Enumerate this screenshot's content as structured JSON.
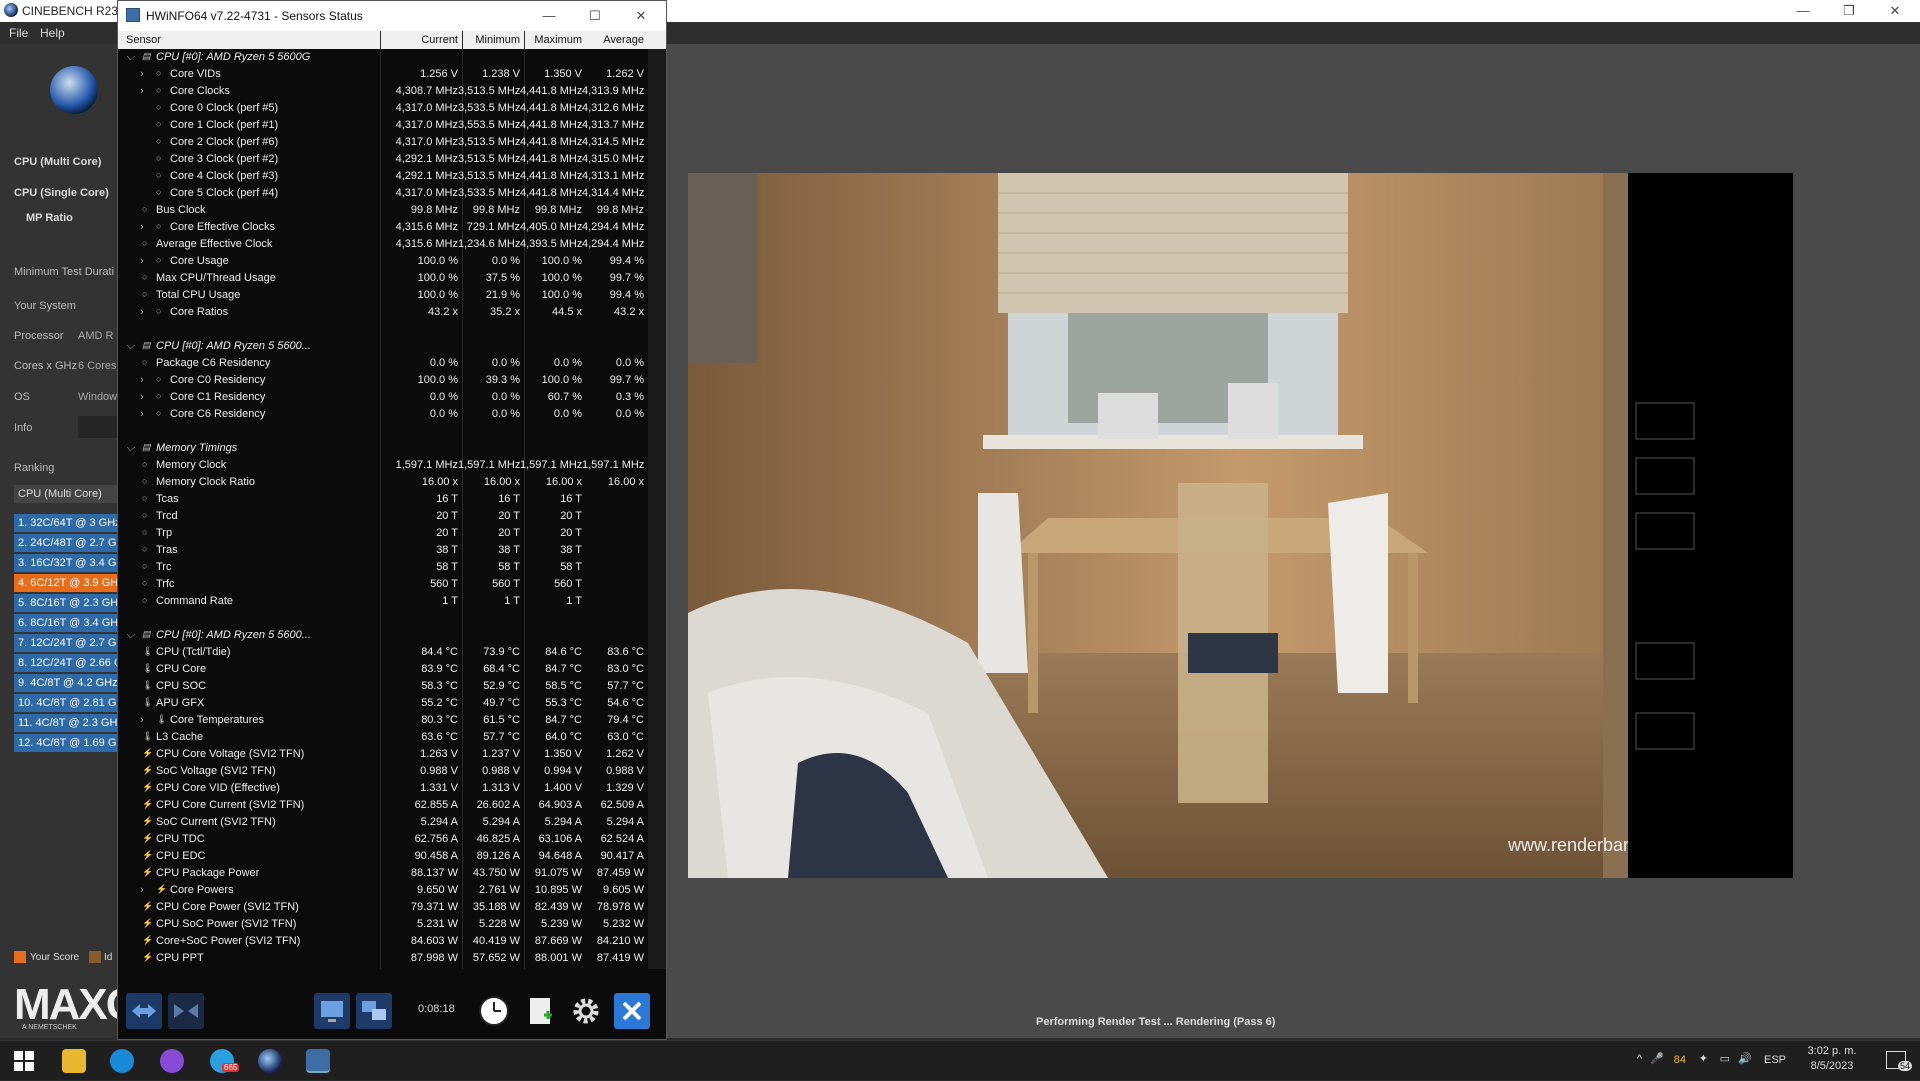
{
  "cinebench": {
    "title": "CINEBENCH R23.2",
    "menu": [
      "File",
      "Help"
    ],
    "side": {
      "cpu_multi": "CPU (Multi Core)",
      "cpu_single": "CPU (Single Core)",
      "mp_ratio": "MP Ratio",
      "min_test": "Minimum Test Durati",
      "your_system": "Your System",
      "processor_label": "Processor",
      "processor_value": "AMD R",
      "cores_label": "Cores x GHz",
      "cores_value": "6 Cores",
      "os_label": "OS",
      "os_value": "Window",
      "info_label": "Info",
      "ranking": "Ranking",
      "ranking_select": "CPU (Multi Core)",
      "your_score": "Your Score",
      "identical": "Id",
      "brand": "MAXO",
      "brand_sub": "A NEMETSCHEK"
    },
    "ranking": [
      "1. 32C/64T @ 3 GHz,",
      "2. 24C/48T @ 2.7 GH",
      "3. 16C/32T @ 3.4 GH",
      "4. 6C/12T @ 3.9 GHz",
      "5. 8C/16T @ 2.3 GHz",
      "6. 8C/16T @ 3.4 GHz",
      "7. 12C/24T @ 2.7 GH",
      "8. 12C/24T @ 2.66 G",
      "9. 4C/8T @ 4.2 GHz,",
      "10. 4C/8T @ 2.81 GH",
      "11. 4C/8T @ 2.3 GHz",
      "12. 4C/8T @ 1.69 GH"
    ],
    "status": "Performing Render Test ... Rendering (Pass 6)",
    "watermark": "www.renderbard"
  },
  "hwinfo": {
    "title": "HWiNFO64 v7.22-4731 - Sensors Status",
    "headers": [
      "Sensor",
      "Current",
      "Minimum",
      "Maximum",
      "Average"
    ],
    "timer": "0:08:18",
    "rows": [
      [
        "g",
        "CPU [#0]: AMD Ryzen 5 5600G",
        "",
        "",
        "",
        ""
      ],
      [
        "e",
        "Core VIDs",
        "1.256 V",
        "1.238 V",
        "1.350 V",
        "1.262 V"
      ],
      [
        "e",
        "Core Clocks",
        "4,308.7 MHz",
        "3,513.5 MHz",
        "4,441.8 MHz",
        "4,313.9 MHz"
      ],
      [
        "s",
        "Core 0 Clock (perf #5)",
        "4,317.0 MHz",
        "3,533.5 MHz",
        "4,441.8 MHz",
        "4,312.6 MHz"
      ],
      [
        "s",
        "Core 1 Clock (perf #1)",
        "4,317.0 MHz",
        "3,553.5 MHz",
        "4,441.8 MHz",
        "4,313.7 MHz"
      ],
      [
        "s",
        "Core 2 Clock (perf #6)",
        "4,317.0 MHz",
        "3,513.5 MHz",
        "4,441.8 MHz",
        "4,314.5 MHz"
      ],
      [
        "s",
        "Core 3 Clock (perf #2)",
        "4,292.1 MHz",
        "3,513.5 MHz",
        "4,441.8 MHz",
        "4,315.0 MHz"
      ],
      [
        "s",
        "Core 4 Clock (perf #3)",
        "4,292.1 MHz",
        "3,513.5 MHz",
        "4,441.8 MHz",
        "4,313.1 MHz"
      ],
      [
        "s",
        "Core 5 Clock (perf #4)",
        "4,317.0 MHz",
        "3,533.5 MHz",
        "4,441.8 MHz",
        "4,314.4 MHz"
      ],
      [
        "i",
        "Bus Clock",
        "99.8 MHz",
        "99.8 MHz",
        "99.8 MHz",
        "99.8 MHz"
      ],
      [
        "e",
        "Core Effective Clocks",
        "4,315.6 MHz",
        "729.1 MHz",
        "4,405.0 MHz",
        "4,294.4 MHz"
      ],
      [
        "i",
        "Average Effective Clock",
        "4,315.6 MHz",
        "1,234.6 MHz",
        "4,393.5 MHz",
        "4,294.4 MHz"
      ],
      [
        "e",
        "Core Usage",
        "100.0 %",
        "0.0 %",
        "100.0 %",
        "99.4 %"
      ],
      [
        "i",
        "Max CPU/Thread Usage",
        "100.0 %",
        "37.5 %",
        "100.0 %",
        "99.7 %"
      ],
      [
        "i",
        "Total CPU Usage",
        "100.0 %",
        "21.9 %",
        "100.0 %",
        "99.4 %"
      ],
      [
        "e",
        "Core Ratios",
        "43.2 x",
        "35.2 x",
        "44.5 x",
        "43.2 x"
      ],
      [
        "b",
        "",
        "",
        "",
        "",
        ""
      ],
      [
        "g",
        "CPU [#0]: AMD Ryzen 5 5600...",
        "",
        "",
        "",
        ""
      ],
      [
        "i",
        "Package C6 Residency",
        "0.0 %",
        "0.0 %",
        "0.0 %",
        "0.0 %"
      ],
      [
        "e",
        "Core C0 Residency",
        "100.0 %",
        "39.3 %",
        "100.0 %",
        "99.7 %"
      ],
      [
        "e",
        "Core C1 Residency",
        "0.0 %",
        "0.0 %",
        "60.7 %",
        "0.3 %"
      ],
      [
        "e",
        "Core C6 Residency",
        "0.0 %",
        "0.0 %",
        "0.0 %",
        "0.0 %"
      ],
      [
        "b",
        "",
        "",
        "",
        "",
        ""
      ],
      [
        "g",
        "Memory Timings",
        "",
        "",
        "",
        ""
      ],
      [
        "i",
        "Memory Clock",
        "1,597.1 MHz",
        "1,597.1 MHz",
        "1,597.1 MHz",
        "1,597.1 MHz"
      ],
      [
        "i",
        "Memory Clock Ratio",
        "16.00 x",
        "16.00 x",
        "16.00 x",
        "16.00 x"
      ],
      [
        "i",
        "Tcas",
        "16 T",
        "16 T",
        "16 T",
        ""
      ],
      [
        "i",
        "Trcd",
        "20 T",
        "20 T",
        "20 T",
        ""
      ],
      [
        "i",
        "Trp",
        "20 T",
        "20 T",
        "20 T",
        ""
      ],
      [
        "i",
        "Tras",
        "38 T",
        "38 T",
        "38 T",
        ""
      ],
      [
        "i",
        "Trc",
        "58 T",
        "58 T",
        "58 T",
        ""
      ],
      [
        "i",
        "Trfc",
        "560 T",
        "560 T",
        "560 T",
        ""
      ],
      [
        "i",
        "Command Rate",
        "1 T",
        "1 T",
        "1 T",
        ""
      ],
      [
        "b",
        "",
        "",
        "",
        "",
        ""
      ],
      [
        "g",
        "CPU [#0]: AMD Ryzen 5 5600...",
        "",
        "",
        "",
        ""
      ],
      [
        "t",
        "CPU (Tctl/Tdie)",
        "84.4 °C",
        "73.9 °C",
        "84.6 °C",
        "83.6 °C"
      ],
      [
        "t",
        "CPU Core",
        "83.9 °C",
        "68.4 °C",
        "84.7 °C",
        "83.0 °C"
      ],
      [
        "t",
        "CPU SOC",
        "58.3 °C",
        "52.9 °C",
        "58.5 °C",
        "57.7 °C"
      ],
      [
        "t",
        "APU GFX",
        "55.2 °C",
        "49.7 °C",
        "55.3 °C",
        "54.6 °C"
      ],
      [
        "te",
        "Core Temperatures",
        "80.3 °C",
        "61.5 °C",
        "84.7 °C",
        "79.4 °C"
      ],
      [
        "t",
        "L3 Cache",
        "63.6 °C",
        "57.7 °C",
        "64.0 °C",
        "63.0 °C"
      ],
      [
        "v",
        "CPU Core Voltage (SVI2 TFN)",
        "1.263 V",
        "1.237 V",
        "1.350 V",
        "1.262 V"
      ],
      [
        "v",
        "SoC Voltage (SVI2 TFN)",
        "0.988 V",
        "0.988 V",
        "0.994 V",
        "0.988 V"
      ],
      [
        "v",
        "CPU Core VID (Effective)",
        "1.331 V",
        "1.313 V",
        "1.400 V",
        "1.329 V"
      ],
      [
        "v",
        "CPU Core Current (SVI2 TFN)",
        "62.855 A",
        "26.602 A",
        "64.903 A",
        "62.509 A"
      ],
      [
        "v",
        "SoC Current (SVI2 TFN)",
        "5.294 A",
        "5.294 A",
        "5.294 A",
        "5.294 A"
      ],
      [
        "v",
        "CPU TDC",
        "62.756 A",
        "46.825 A",
        "63.106 A",
        "62.524 A"
      ],
      [
        "v",
        "CPU EDC",
        "90.458 A",
        "89.126 A",
        "94.648 A",
        "90.417 A"
      ],
      [
        "v",
        "CPU Package Power",
        "88.137 W",
        "43.750 W",
        "91.075 W",
        "87.459 W"
      ],
      [
        "ve",
        "Core Powers",
        "9.650 W",
        "2.761 W",
        "10.895 W",
        "9.605 W"
      ],
      [
        "v",
        "CPU Core Power (SVI2 TFN)",
        "79.371 W",
        "35.188 W",
        "82.439 W",
        "78.978 W"
      ],
      [
        "v",
        "CPU SoC Power (SVI2 TFN)",
        "5.231 W",
        "5.228 W",
        "5.239 W",
        "5.232 W"
      ],
      [
        "v",
        "Core+SoC Power (SVI2 TFN)",
        "84.603 W",
        "40.419 W",
        "87.669 W",
        "84.210 W"
      ],
      [
        "v",
        "CPU PPT",
        "87.998 W",
        "57.652 W",
        "88.001 W",
        "87.419 W"
      ]
    ]
  },
  "taskbar": {
    "time": "3:02 p. m.",
    "date": "8/5/2023",
    "lang": "ESP",
    "temp": "84",
    "notif": "54",
    "badge": "665"
  }
}
